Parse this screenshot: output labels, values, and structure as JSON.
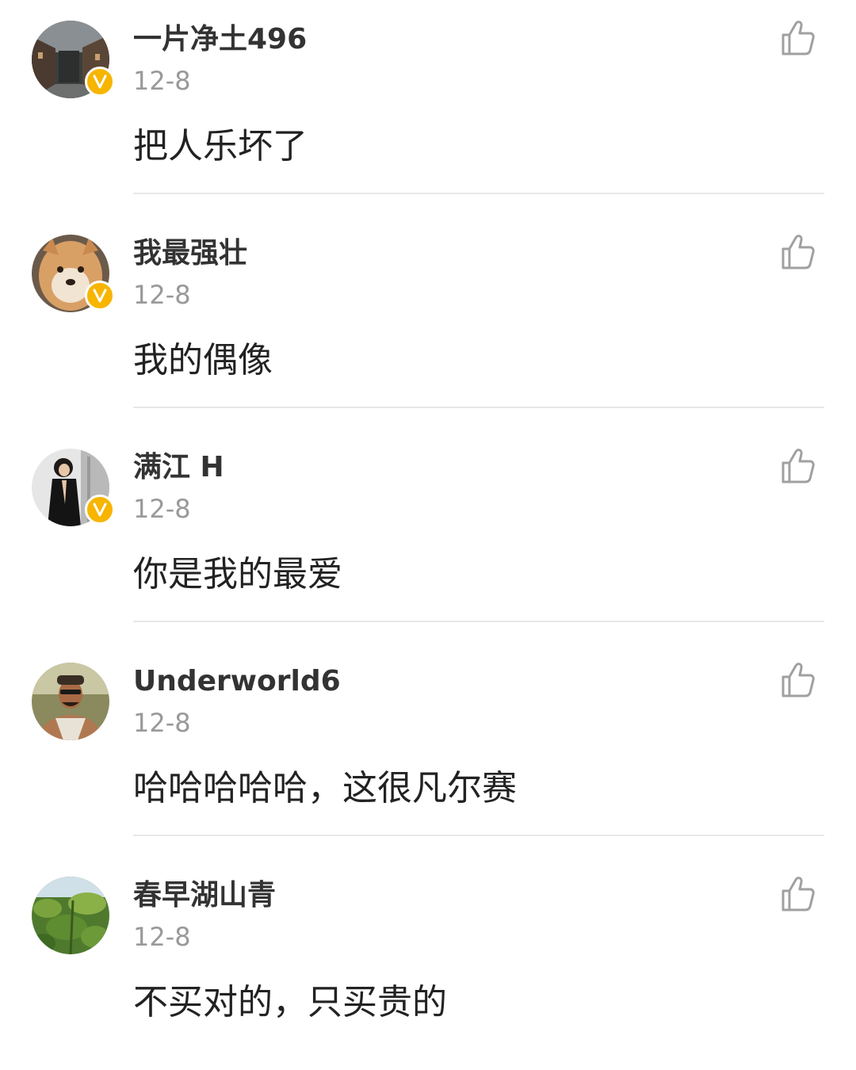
{
  "comments": [
    {
      "username": "一片净土496",
      "date": "12-8",
      "text": "把人乐坏了",
      "verified": true,
      "avatar": "street-photo"
    },
    {
      "username": "我最强壮",
      "date": "12-8",
      "text": "我的偶像",
      "verified": true,
      "avatar": "shiba-dog-photo"
    },
    {
      "username": "满江 H",
      "date": "12-8",
      "text": "你是我的最爱",
      "verified": true,
      "avatar": "woman-in-black-photo"
    },
    {
      "username": "Underworld6",
      "date": "12-8",
      "text": "哈哈哈哈哈，这很凡尔赛",
      "verified": false,
      "avatar": "man-with-cap-photo"
    },
    {
      "username": "春早湖山青",
      "date": "12-8",
      "text": "不买对的，只买贵的",
      "verified": false,
      "avatar": "green-plants-photo"
    }
  ],
  "icons": {
    "like": "thumbs-up-outline-icon",
    "verified": "verified-v-badge-icon"
  },
  "colors": {
    "verified_badge": "#f7b500",
    "username": "#333333",
    "date": "#999999",
    "text": "#222222",
    "divider": "#e8e8e8",
    "icon": "#a0a0a0"
  }
}
